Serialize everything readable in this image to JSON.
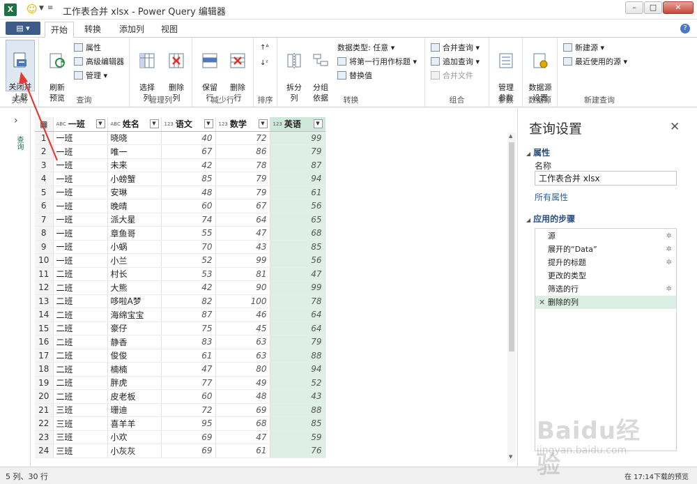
{
  "window": {
    "title": "工作表合并 xlsx - Power Query 编辑器",
    "app_icon_letter": "X"
  },
  "ribbon_tabs": {
    "file_label": "",
    "tabs": [
      "开始",
      "转换",
      "添加列",
      "视图"
    ]
  },
  "ribbon": {
    "close": {
      "button": "关闭并\n上载",
      "group": "关闭"
    },
    "query": {
      "refresh": "刷新\n预览",
      "properties": "属性",
      "advanced_editor": "高级编辑器",
      "manage": "管理",
      "group": "查询"
    },
    "manage_columns": {
      "choose": "选择\n列",
      "remove": "删除\n列",
      "group": "管理列"
    },
    "reduce_rows": {
      "keep": "保留\n行",
      "remove": "删除\n行",
      "group": "减少行"
    },
    "sort": {
      "group": "排序"
    },
    "transform": {
      "split": "拆分\n列",
      "group_by": "分组\n依据",
      "data_type": "数据类型: 任意",
      "first_row_header": "将第一行用作标题",
      "replace_values": "替换值",
      "group": "转换"
    },
    "combine": {
      "merge": "合并查询",
      "append": "追加查询",
      "combine_files": "合并文件",
      "group": "组合"
    },
    "parameters": {
      "manage": "管理\n参数",
      "group": "参数"
    },
    "datasource": {
      "settings": "数据源\n设置",
      "group": "数据源"
    },
    "new_query": {
      "new_source": "新建源",
      "recent": "最近使用的源",
      "group": "新建查询"
    }
  },
  "grid": {
    "columns": [
      {
        "type": "ABC",
        "name": "一班"
      },
      {
        "type": "ABC",
        "name": "姓名"
      },
      {
        "type": "123",
        "name": "语文"
      },
      {
        "type": "123",
        "name": "数学"
      },
      {
        "type": "123",
        "name": "英语"
      }
    ],
    "rows": [
      [
        "1",
        "一班",
        "晓晓",
        "40",
        "72",
        "99"
      ],
      [
        "2",
        "一班",
        "唯一",
        "67",
        "86",
        "79"
      ],
      [
        "3",
        "一班",
        "未来",
        "42",
        "78",
        "87"
      ],
      [
        "4",
        "一班",
        "小螃蟹",
        "85",
        "79",
        "94"
      ],
      [
        "5",
        "一班",
        "安琳",
        "48",
        "79",
        "61"
      ],
      [
        "6",
        "一班",
        "晚晴",
        "60",
        "67",
        "56"
      ],
      [
        "7",
        "一班",
        "派大星",
        "74",
        "64",
        "65"
      ],
      [
        "8",
        "一班",
        "章鱼哥",
        "55",
        "47",
        "68"
      ],
      [
        "9",
        "一班",
        "小蜗",
        "70",
        "43",
        "85"
      ],
      [
        "10",
        "一班",
        "小兰",
        "52",
        "99",
        "56"
      ],
      [
        "11",
        "二班",
        "村长",
        "53",
        "81",
        "47"
      ],
      [
        "12",
        "二班",
        "大熊",
        "42",
        "90",
        "99"
      ],
      [
        "13",
        "二班",
        "哆啦A梦",
        "82",
        "100",
        "78"
      ],
      [
        "14",
        "二班",
        "海绵宝宝",
        "87",
        "46",
        "64"
      ],
      [
        "15",
        "二班",
        "豪仔",
        "75",
        "45",
        "64"
      ],
      [
        "16",
        "二班",
        "静香",
        "83",
        "63",
        "79"
      ],
      [
        "17",
        "二班",
        "俊俊",
        "61",
        "63",
        "88"
      ],
      [
        "18",
        "二班",
        "楠楠",
        "47",
        "80",
        "94"
      ],
      [
        "19",
        "二班",
        "胖虎",
        "77",
        "49",
        "52"
      ],
      [
        "20",
        "二班",
        "皮老板",
        "60",
        "48",
        "43"
      ],
      [
        "21",
        "三班",
        "珊迪",
        "72",
        "69",
        "88"
      ],
      [
        "22",
        "三班",
        "喜羊羊",
        "95",
        "68",
        "85"
      ],
      [
        "23",
        "三班",
        "小欢",
        "69",
        "47",
        "59"
      ],
      [
        "24",
        "三班",
        "小灰灰",
        "69",
        "61",
        "76"
      ]
    ]
  },
  "left_strip": {
    "label": "查询"
  },
  "settings": {
    "title": "查询设置",
    "properties_head": "属性",
    "name_label": "名称",
    "name_value": "工作表合并 xlsx",
    "all_properties": "所有属性",
    "steps_head": "应用的步骤",
    "steps": [
      {
        "label": "源",
        "gear": true
      },
      {
        "label": "展开的“Data”",
        "gear": true
      },
      {
        "label": "提升的标题",
        "gear": true
      },
      {
        "label": "更改的类型",
        "gear": false
      },
      {
        "label": "筛选的行",
        "gear": true
      },
      {
        "label": "删除的列",
        "gear": false,
        "selected": true
      }
    ]
  },
  "status": {
    "left": "5 列、30 行",
    "right": "在 17:14下载的预览"
  },
  "watermark": {
    "text": "Baidu经验",
    "url": "jingyan.baidu.com"
  },
  "colors": {
    "accent": "#1e7145",
    "highlight_column": "#ddefe6",
    "link": "#2a5fa8",
    "annotation": "#e53935"
  }
}
